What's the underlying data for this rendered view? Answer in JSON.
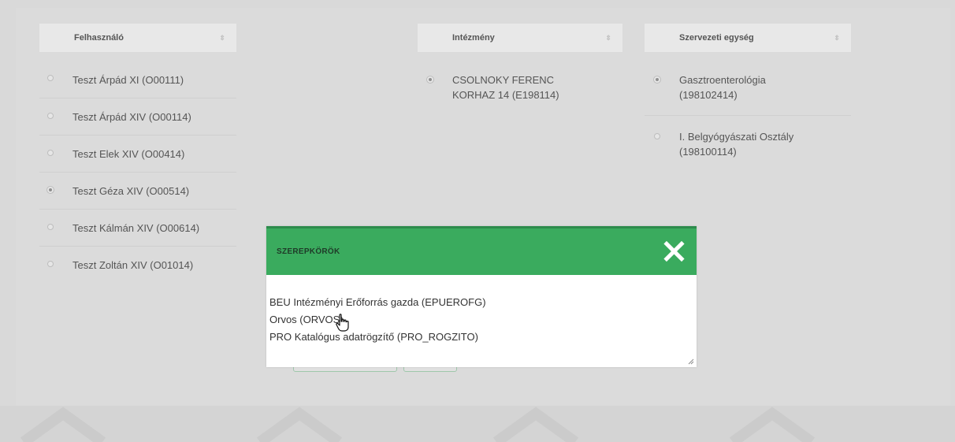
{
  "columns": {
    "user": {
      "header": "Felhasználó"
    },
    "institution": {
      "header": "Intézmény"
    },
    "unit": {
      "header": "Szervezeti egység"
    },
    "sort_icon": "⇳"
  },
  "users": [
    {
      "label": "Teszt Árpád XI (O00111)",
      "selected": false
    },
    {
      "label": "Teszt Árpád XIV (O00114)",
      "selected": false
    },
    {
      "label": "Teszt Elek XIV (O00414)",
      "selected": false
    },
    {
      "label": "Teszt Géza XIV (O00514)",
      "selected": true
    },
    {
      "label": "Teszt Kálmán XIV (O00614)",
      "selected": false
    },
    {
      "label": "Teszt Zoltán XIV (O01014)",
      "selected": false
    }
  ],
  "institutions": [
    {
      "label": "CSOLNOKY FERENC\nKORHAZ 14 (E198114)",
      "selected": true
    }
  ],
  "units": [
    {
      "label": "Gasztroenterológia\n(198102414)",
      "selected": true
    },
    {
      "label": "I. Belgyógyászati Osztály\n(198100114)",
      "selected": false
    }
  ],
  "modal": {
    "title": "SZEREPKÖRÖK",
    "close_icon": "close-icon",
    "roles": [
      "BEU Intézményi Erőforrás gazda (EPUEROFG)",
      "Orvos (ORVOS)",
      "PRO Katalógus adatrögzítő (PRO_ROGZITO)"
    ]
  },
  "colors": {
    "accent": "#3aab5e",
    "background": "#d9d9d9"
  }
}
